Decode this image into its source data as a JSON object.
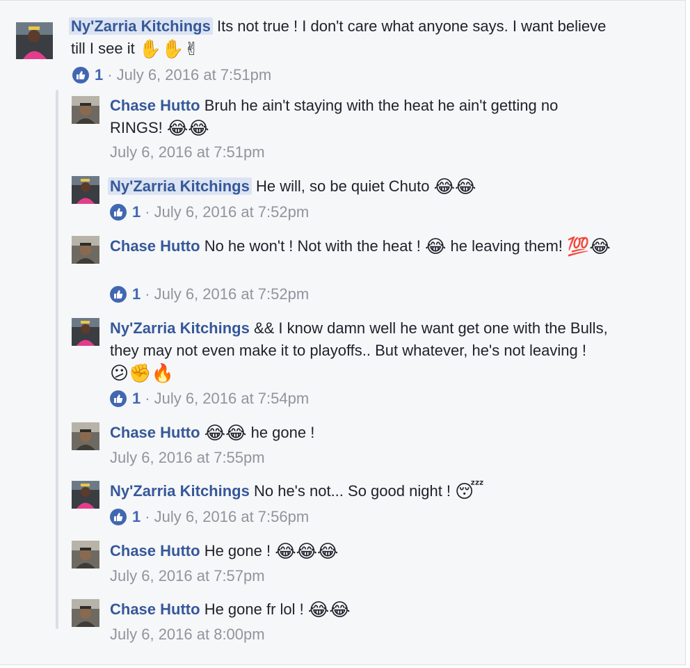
{
  "thread": {
    "top": {
      "author": "Ny'Zarria Kitchings",
      "text": "Its not true ! I don't care what anyone says. I want believe till I see it",
      "emojis": "✋✋✌",
      "likes": "1",
      "timestamp": "July 6, 2016 at 7:51pm"
    },
    "replies": [
      {
        "author": "Chase Hutto",
        "text": "Bruh he ain't staying with the heat he ain't getting no RINGS!",
        "emojis": "😂😂",
        "likes": "",
        "timestamp": "July 6, 2016 at 7:51pm"
      },
      {
        "author": "Ny'Zarria Kitchings",
        "text": "He will, so be quiet Chuto",
        "emojis": "😂😂",
        "likes": "1",
        "timestamp": "July 6, 2016 at 7:52pm"
      },
      {
        "author": "Chase Hutto",
        "text": "No he won't ! Not with the heat !",
        "emoji_mid": "😂",
        "text2": "he leaving them!",
        "emojis": "💯😂",
        "likes": "1",
        "timestamp": "July 6, 2016 at 7:52pm"
      },
      {
        "author": "Ny'Zarria Kitchings",
        "text": "&& I know damn well he want get one with the Bulls, they may not even make it to playoffs.. But whatever, he's not leaving !",
        "emojis": "😕✊🔥",
        "likes": "1",
        "timestamp": "July 6, 2016 at 7:54pm"
      },
      {
        "author": "Chase Hutto",
        "emojis_lead": "😂😂",
        "text": "he gone !",
        "likes": "",
        "timestamp": "July 6, 2016 at 7:55pm"
      },
      {
        "author": "Ny'Zarria Kitchings",
        "text": "No he's not... So good night !",
        "emojis": "😴",
        "likes": "1",
        "timestamp": "July 6, 2016 at 7:56pm"
      },
      {
        "author": "Chase Hutto",
        "text": "He gone !",
        "emojis": "😂😂😂",
        "likes": "",
        "timestamp": "July 6, 2016 at 7:57pm"
      },
      {
        "author": "Chase Hutto",
        "text": "He gone fr lol !",
        "emojis": "😂😂",
        "likes": "",
        "timestamp": "July 6, 2016 at 8:00pm"
      }
    ]
  },
  "meta": {
    "separator": "·"
  },
  "colors": {
    "name": "#365899",
    "timestamp": "#90949c",
    "like": "#4267b2",
    "panel": "#f6f7f9"
  }
}
